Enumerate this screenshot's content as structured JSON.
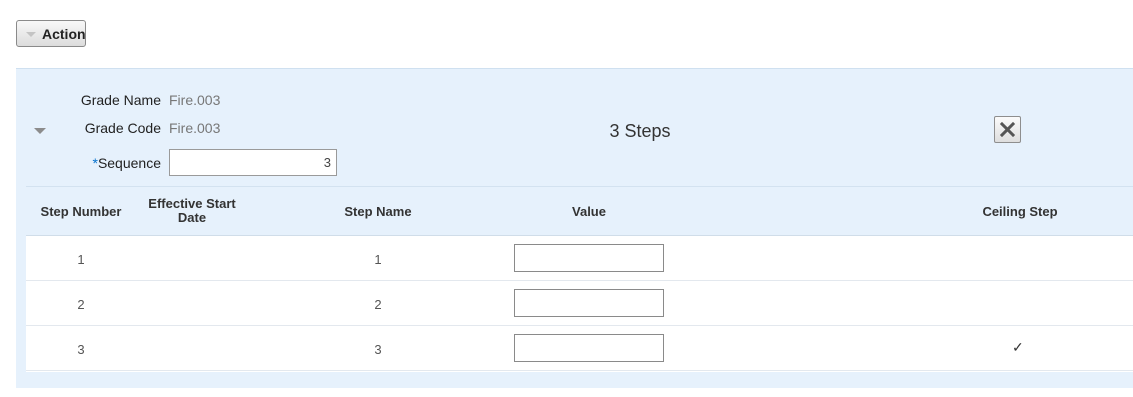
{
  "toolbar": {
    "action_label": "Action"
  },
  "grade": {
    "name_label": "Grade Name",
    "name_value": "Fire.003",
    "code_label": "Grade Code",
    "code_value": "Fire.003",
    "sequence_required_mark": "*",
    "sequence_label": "Sequence",
    "sequence_value": "3",
    "steps_title": "3 Steps"
  },
  "table": {
    "headers": {
      "step_number": "Step Number",
      "effective_start_date_line1": "Effective Start",
      "effective_start_date_line2": "Date",
      "step_name": "Step Name",
      "value": "Value",
      "ceiling_step": "Ceiling Step"
    },
    "rows": [
      {
        "step_number": "1",
        "step_name": "1",
        "value": "",
        "ceiling": ""
      },
      {
        "step_number": "2",
        "step_name": "2",
        "value": "",
        "ceiling": ""
      },
      {
        "step_number": "3",
        "step_name": "3",
        "value": "",
        "ceiling": "✓"
      }
    ]
  },
  "icons": {
    "action_caret": "chevron-down-icon",
    "expand": "collapse-triangle-icon",
    "close": "close-icon",
    "ceiling": "checkmark-icon"
  },
  "colors": {
    "panel_bg": "#e6f1fc",
    "required_mark": "#0572ce"
  }
}
